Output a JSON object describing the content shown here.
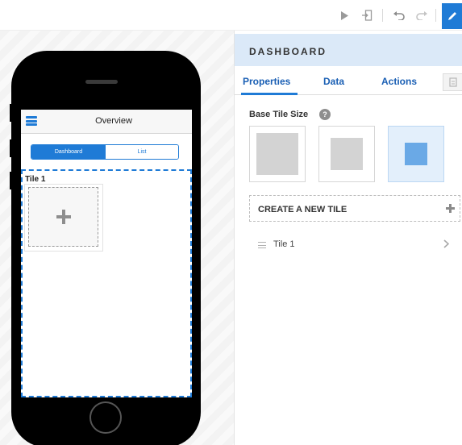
{
  "toolbar": {
    "icons": [
      "run-icon",
      "export-icon",
      "undo-icon",
      "redo-icon",
      "edit-icon"
    ],
    "colors": {
      "accent": "#1f7bd6"
    }
  },
  "preview": {
    "header_title": "Overview",
    "segment": {
      "options": [
        "Dashboard",
        "List"
      ],
      "selected": "Dashboard"
    },
    "tiles": [
      {
        "label": "Tile 1"
      }
    ]
  },
  "panel": {
    "title": "DASHBOARD",
    "tabs": [
      {
        "label": "Properties",
        "active": true
      },
      {
        "label": "Data",
        "active": false
      },
      {
        "label": "Actions",
        "active": false
      }
    ],
    "base_tile_size": {
      "label": "Base Tile Size",
      "help_glyph": "?",
      "options": [
        "large",
        "medium",
        "small"
      ],
      "selected": "small"
    },
    "create_label": "CREATE A NEW TILE",
    "tile_items": [
      {
        "label": "Tile 1"
      }
    ]
  }
}
